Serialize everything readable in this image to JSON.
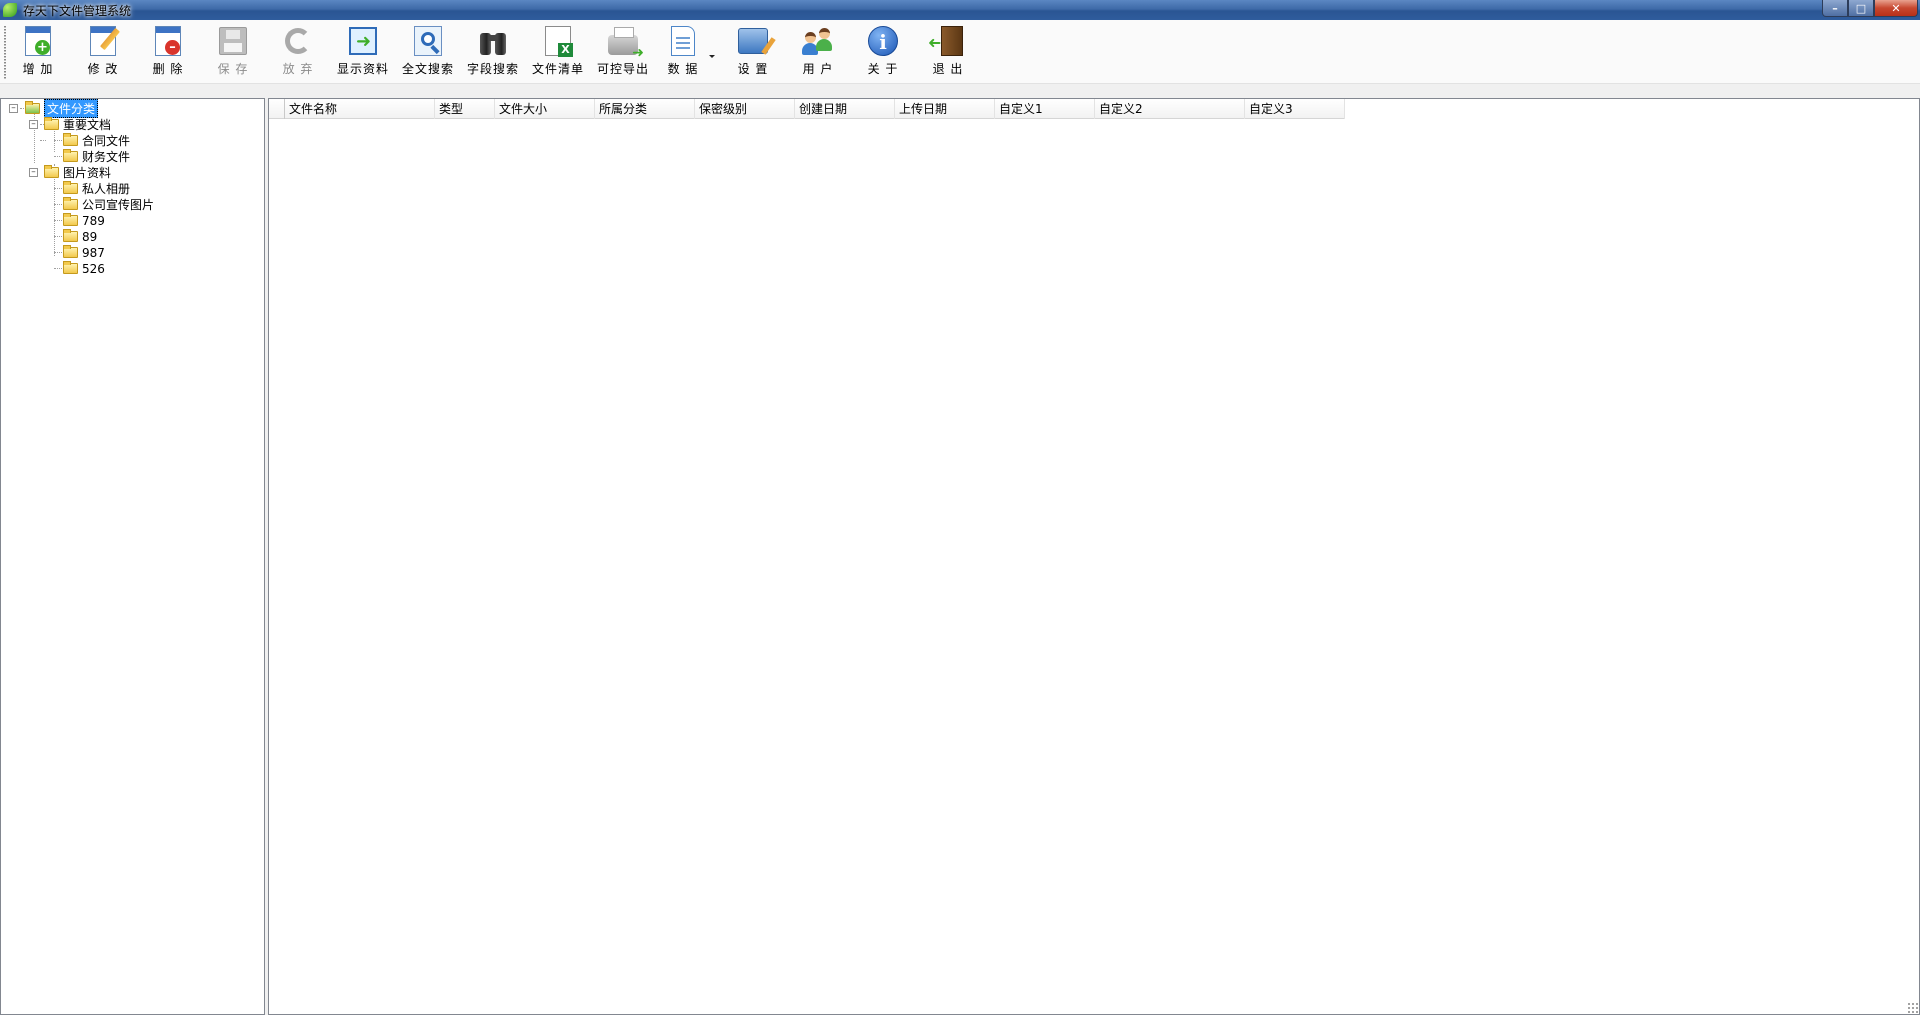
{
  "window": {
    "title": "存天下文件管理系统",
    "controls": {
      "minimize": "–",
      "maximize": "□",
      "close": "✕"
    }
  },
  "toolbar": {
    "items": [
      {
        "id": "add",
        "label": "增 加",
        "icon": "add-doc-icon",
        "enabled": true
      },
      {
        "id": "edit",
        "label": "修 改",
        "icon": "edit-doc-icon",
        "enabled": true
      },
      {
        "id": "delete",
        "label": "删 除",
        "icon": "delete-doc-icon",
        "enabled": true
      },
      {
        "id": "save",
        "label": "保 存",
        "icon": "floppy-icon",
        "enabled": false
      },
      {
        "id": "discard",
        "label": "放 弃",
        "icon": "undo-icon",
        "enabled": false
      },
      {
        "id": "show",
        "label": "显示资料",
        "icon": "show-doc-icon",
        "enabled": true
      },
      {
        "id": "fulltext",
        "label": "全文搜索",
        "icon": "fulltext-search-icon",
        "enabled": true
      },
      {
        "id": "fieldsearch",
        "label": "字段搜索",
        "icon": "binoculars-icon",
        "enabled": true
      },
      {
        "id": "filelist",
        "label": "文件清单",
        "icon": "excel-list-icon",
        "enabled": true
      },
      {
        "id": "export",
        "label": "可控导出",
        "icon": "printer-export-icon",
        "enabled": true
      },
      {
        "id": "data",
        "label": "数 据",
        "icon": "data-doc-icon",
        "enabled": true,
        "dropdown": true
      },
      {
        "id": "settings",
        "label": "设 置",
        "icon": "settings-icon",
        "enabled": true
      },
      {
        "id": "users",
        "label": "用 户",
        "icon": "users-icon",
        "enabled": true
      },
      {
        "id": "about",
        "label": "关 于",
        "icon": "info-icon",
        "enabled": true
      },
      {
        "id": "exit",
        "label": "退 出",
        "icon": "exit-door-icon",
        "enabled": true
      }
    ]
  },
  "tree": {
    "root": {
      "label": "文件分类",
      "selected": true,
      "expander": "⊟"
    },
    "groups": [
      {
        "label": "重要文档",
        "expander": "⊟",
        "children": [
          "合同文件",
          "财务文件"
        ]
      },
      {
        "label": "图片资料",
        "expander": "⊟",
        "children": [
          "私人相册",
          "公司宣传图片",
          "789",
          "89",
          "987",
          "526"
        ]
      }
    ]
  },
  "grid": {
    "columns": [
      "文件名称",
      "类型",
      "文件大小",
      "所属分类",
      "保密级别",
      "创建日期",
      "上传日期",
      "自定义1",
      "自定义2",
      "自定义3"
    ],
    "rows": []
  }
}
